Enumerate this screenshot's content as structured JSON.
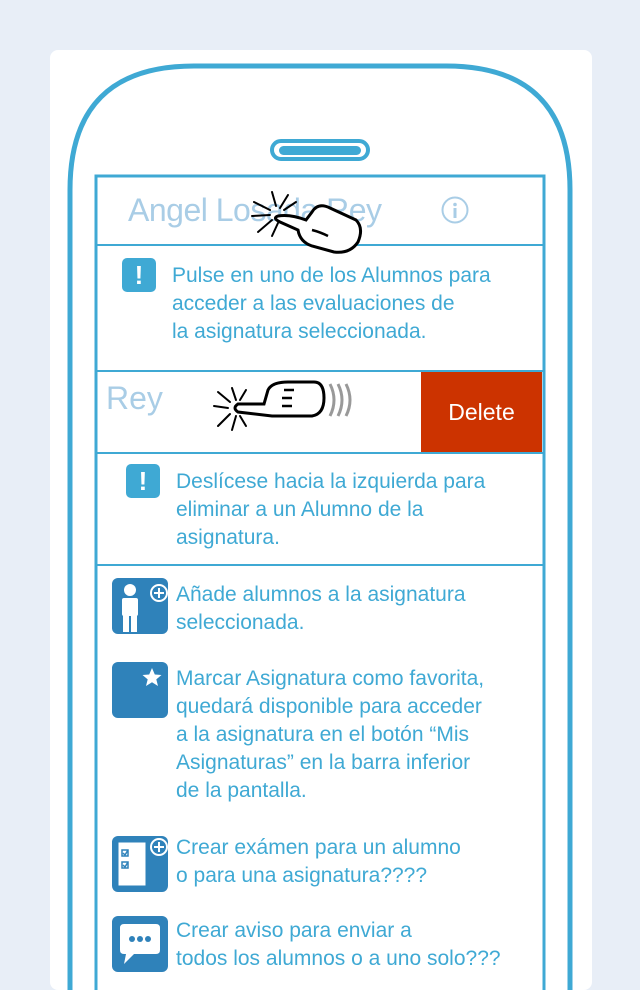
{
  "header": {
    "student_name": "Angel Losada Rey"
  },
  "hints": {
    "tap_student": "Pulse en uno de los Alumnos para acceder a las evaluaciones de la asignatura seleccionada.",
    "tap_line1": "Pulse en uno de los Alumnos para",
    "tap_line2": "acceder a las evaluaciones de",
    "tap_line3": "la asignatura seleccionada.",
    "swipe_line1": "Deslícese hacia la izquierda para",
    "swipe_line2": "eliminar a un Alumno de la",
    "swipe_line3": "asignatura."
  },
  "swipe_row": {
    "name_partial": "Rey",
    "delete_label": "Delete"
  },
  "features": {
    "add_line1": "Añade alumnos a la asignatura",
    "add_line2": "seleccionada.",
    "fav_line1": "Marcar Asignatura como favorita,",
    "fav_line2": "quedará disponible para acceder",
    "fav_line3": "a la asignatura en el botón “Mis",
    "fav_line4": "Asignaturas” en la barra inferior",
    "fav_line5": "de la pantalla.",
    "exam_line1": "Crear exámen para un alumno",
    "exam_line2": "o para una asignatura????",
    "notice_line1": "Crear aviso para enviar a",
    "notice_line2": "todos los alumnos o a uno solo???"
  },
  "colors": {
    "accent": "#3fa9d4",
    "icon_bg": "#2f82ba",
    "delete_bg": "#cc3300",
    "faded_text": "#a9cde6"
  },
  "icons": [
    "info-icon",
    "warning-icon",
    "tap-gesture-icon",
    "swipe-gesture-icon",
    "add-student-icon",
    "favorite-star-icon",
    "create-exam-icon",
    "message-icon"
  ]
}
